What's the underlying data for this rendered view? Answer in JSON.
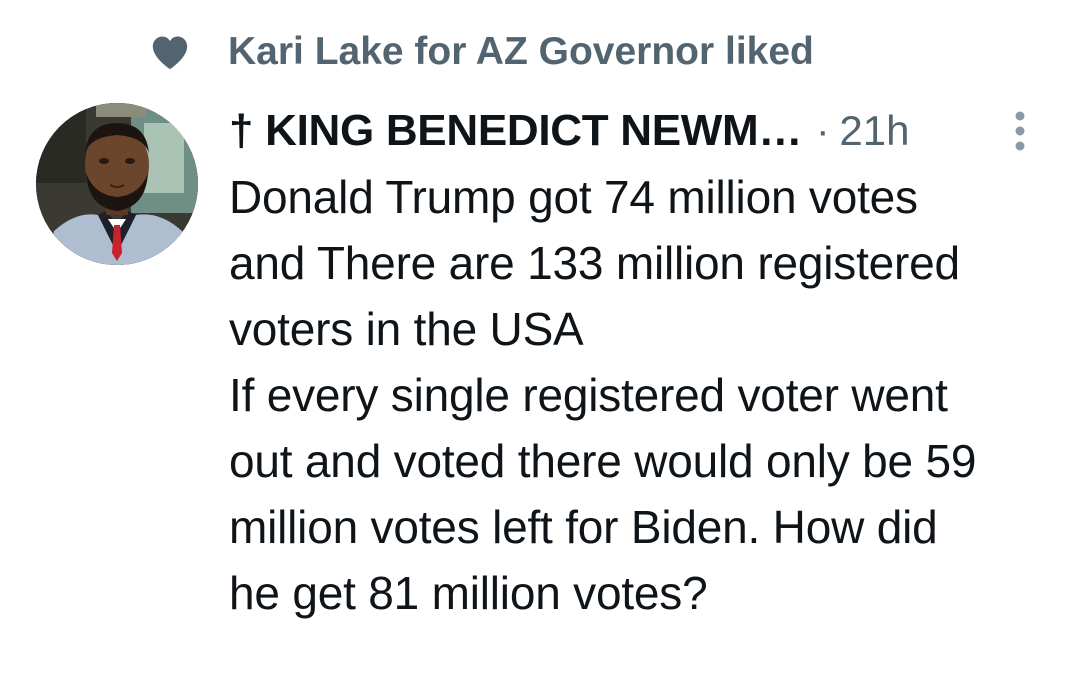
{
  "social_context": {
    "icon": "heart-icon",
    "text": "Kari Lake for AZ Governor liked"
  },
  "tweet": {
    "author_name": "† KING BENEDICT NEWM…",
    "separator": "·",
    "time": "21h",
    "more_icon": "vertical-ellipsis-icon",
    "avatar_icon": "profile-photo",
    "text": "Donald Trump got 74 million votes\nand There are 133 million registered\nvoters in the USA\nIf every single registered voter went\nout and voted there would only be 59\nmillion votes left for Biden. How did\nhe get 81 million votes?"
  },
  "colors": {
    "primary_text": "#0f1419",
    "secondary_text": "#536471",
    "background": "#ffffff"
  }
}
